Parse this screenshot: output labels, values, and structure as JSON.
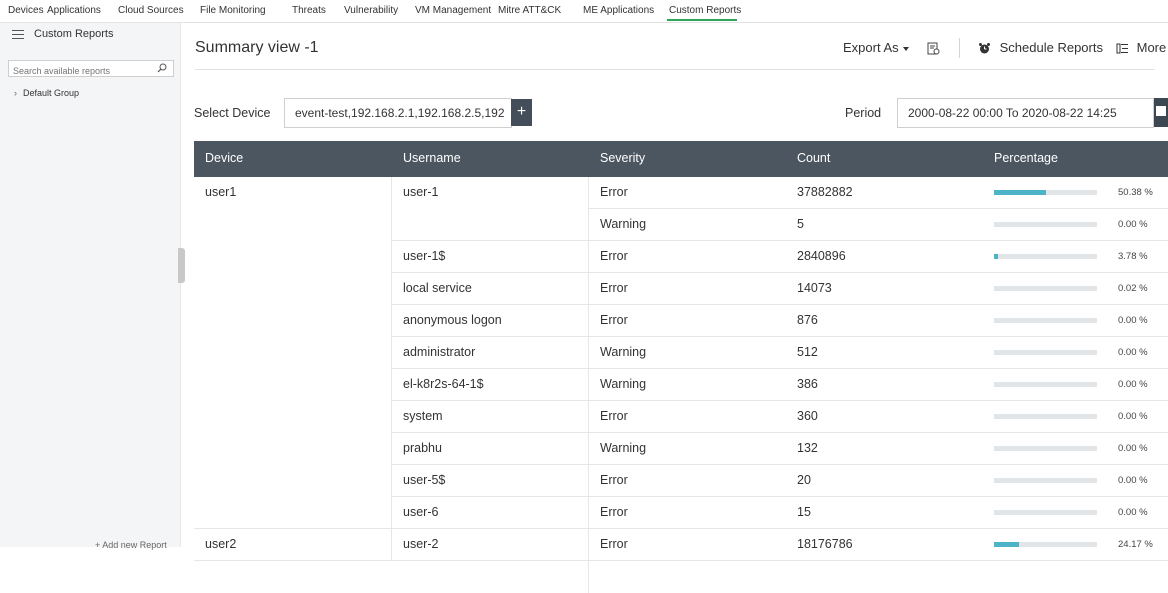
{
  "topnav": {
    "tabs": [
      "Devices",
      "Applications",
      "Cloud Sources",
      "File Monitoring",
      "Threats",
      "Vulnerability",
      "VM Management",
      "Mitre ATT&CK",
      "ME Applications",
      "Custom Reports"
    ],
    "active": "Custom Reports"
  },
  "sidebar": {
    "title": "Custom Reports",
    "search_placeholder": "Search available reports",
    "group": "Default Group",
    "add_report": "+ Add new Report"
  },
  "main": {
    "title": "Summary view -1",
    "export_label": "Export As",
    "schedule_label": "Schedule Reports",
    "more_label": "More",
    "select_device_label": "Select Device",
    "device_value": "event-test,192.168.2.1,192.168.2.5,192.",
    "add_device_button": "+",
    "period_label": "Period",
    "period_value": "2000-08-22 00:00 To 2020-08-22 14:25"
  },
  "table": {
    "headers": [
      "Device",
      "Username",
      "Severity",
      "Count",
      "Percentage"
    ],
    "rows": [
      {
        "device": "user1",
        "username": "user-1",
        "severity": "Error",
        "count": "37882882",
        "pct": "50.38 %",
        "pct_value": 50.38
      },
      {
        "device": "",
        "username": "",
        "severity": "Warning",
        "count": "5",
        "pct": "0.00 %",
        "pct_value": 0
      },
      {
        "device": "",
        "username": "user-1$",
        "severity": "Error",
        "count": "2840896",
        "pct": "3.78 %",
        "pct_value": 3.78
      },
      {
        "device": "",
        "username": "local service",
        "severity": "Error",
        "count": "14073",
        "pct": "0.02 %",
        "pct_value": 0.02
      },
      {
        "device": "",
        "username": "anonymous logon",
        "severity": "Error",
        "count": "876",
        "pct": "0.00 %",
        "pct_value": 0
      },
      {
        "device": "",
        "username": "administrator",
        "severity": "Warning",
        "count": "512",
        "pct": "0.00 %",
        "pct_value": 0
      },
      {
        "device": "",
        "username": "el-k8r2s-64-1$",
        "severity": "Warning",
        "count": "386",
        "pct": "0.00 %",
        "pct_value": 0
      },
      {
        "device": "",
        "username": "system",
        "severity": "Error",
        "count": "360",
        "pct": "0.00 %",
        "pct_value": 0
      },
      {
        "device": "",
        "username": "prabhu",
        "severity": "Warning",
        "count": "132",
        "pct": "0.00 %",
        "pct_value": 0
      },
      {
        "device": "",
        "username": "user-5$",
        "severity": "Error",
        "count": "20",
        "pct": "0.00 %",
        "pct_value": 0
      },
      {
        "device": "",
        "username": "user-6",
        "severity": "Error",
        "count": "15",
        "pct": "0.00 %",
        "pct_value": 0
      },
      {
        "device": "user2",
        "username": "user-2",
        "severity": "Error",
        "count": "18176786",
        "pct": "24.17 %",
        "pct_value": 24.17
      }
    ]
  },
  "colors": {
    "header_bg": "#4b5661",
    "bar_fill": "#4db3c6",
    "bar_track": "#e2e5e8",
    "active_tab_underline": "#2ea65a"
  }
}
